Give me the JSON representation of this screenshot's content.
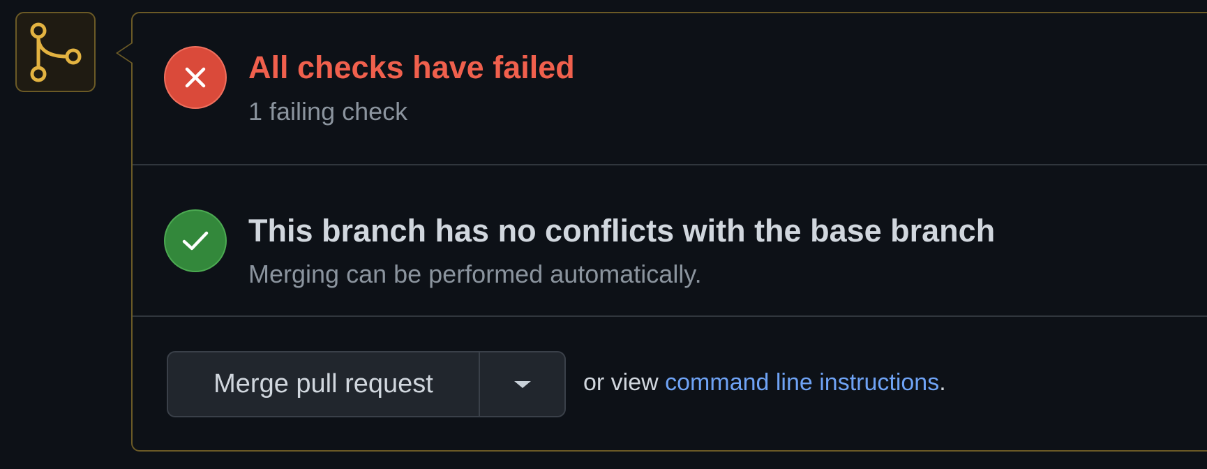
{
  "checks": {
    "title": "All checks have failed",
    "subtitle": "1 failing check",
    "icon": "x-circle-icon"
  },
  "conflicts": {
    "title": "This branch has no conflicts with the base branch",
    "subtitle": "Merging can be performed automatically.",
    "icon": "check-circle-icon"
  },
  "merge": {
    "button_label": "Merge pull request",
    "dropdown_icon": "caret-down-icon",
    "prefix_text": "or view ",
    "link_text": "command line instructions",
    "suffix_text": "."
  },
  "header_icon": "git-merge-icon",
  "colors": {
    "background": "#0d1117",
    "panel_border": "#6b5a26",
    "merge_icon": "#e3b341",
    "failure_red": "#da4a3a",
    "failure_text": "#f0604d",
    "success_green": "#33883b",
    "link_blue": "#6fa3f5",
    "muted_text": "#8b949e"
  }
}
